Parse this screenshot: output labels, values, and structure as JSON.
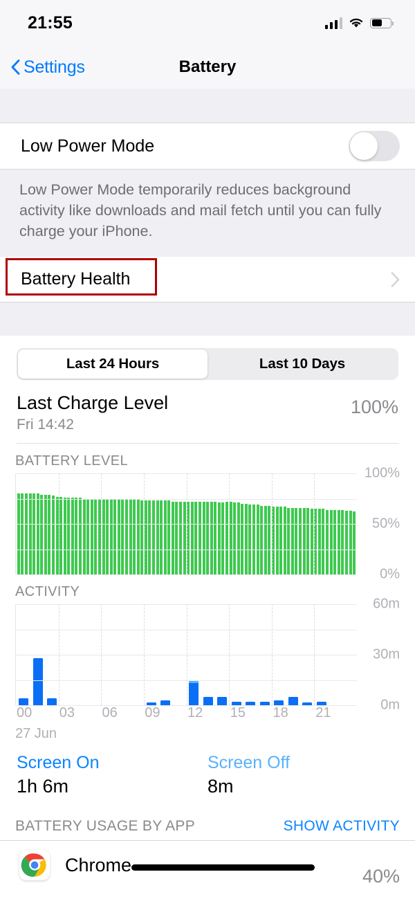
{
  "status_bar": {
    "time": "21:55",
    "signal_icon": "cellular-signal-icon",
    "wifi_icon": "wifi-icon",
    "battery_icon": "battery-icon",
    "battery_fill_pct": 55
  },
  "nav": {
    "back_label": "Settings",
    "title": "Battery",
    "back_icon": "chevron-left-icon",
    "accent": "#007aff"
  },
  "low_power": {
    "label": "Low Power Mode",
    "toggle_state": "off",
    "footnote": "Low Power Mode temporarily reduces background activity like downloads and mail fetch until you can fully charge your iPhone."
  },
  "battery_health": {
    "label": "Battery Health",
    "disclosure_icon": "chevron-right-icon",
    "highlight_color": "#b00000"
  },
  "segmented": {
    "options": [
      {
        "label": "Last 24 Hours",
        "selected": true
      },
      {
        "label": "Last 10 Days",
        "selected": false
      }
    ]
  },
  "last_charge": {
    "title": "Last Charge Level",
    "subtitle": "Fri 14:42",
    "value": "100%"
  },
  "chart_data": [
    {
      "type": "bar",
      "title": "BATTERY LEVEL",
      "xlabel": "",
      "ylabel": "",
      "ylim": [
        0,
        100
      ],
      "ytick_labels": [
        "100%",
        "50%",
        "0%"
      ],
      "ytick_values": [
        100,
        50,
        0
      ],
      "gridlines": [
        100,
        75,
        50,
        25,
        0
      ],
      "grid": true,
      "bar_color": "#3ec94f",
      "x": [
        "00",
        "00",
        "00",
        "00",
        "01",
        "01",
        "01",
        "01",
        "02",
        "02",
        "02",
        "02",
        "03",
        "03",
        "03",
        "03",
        "04",
        "04",
        "04",
        "04",
        "05",
        "05",
        "05",
        "05",
        "06",
        "06",
        "06",
        "06",
        "07",
        "07",
        "07",
        "07",
        "08",
        "08",
        "08",
        "08",
        "09",
        "09",
        "09",
        "09",
        "10",
        "10",
        "10",
        "10",
        "11",
        "11",
        "11",
        "11",
        "12",
        "12",
        "12",
        "12",
        "13",
        "13",
        "13",
        "13",
        "14",
        "14",
        "14",
        "14",
        "15",
        "15",
        "15",
        "15",
        "16",
        "16",
        "16",
        "16",
        "17",
        "17",
        "17",
        "17",
        "18",
        "18",
        "18",
        "18",
        "19",
        "19",
        "19",
        "19",
        "20",
        "20",
        "20",
        "20",
        "21",
        "21",
        "21",
        "21"
      ],
      "values": [
        80,
        80,
        80,
        80,
        80,
        80,
        79,
        79,
        79,
        78,
        77,
        77,
        76,
        76,
        76,
        76,
        76,
        75,
        75,
        75,
        75,
        75,
        75,
        75,
        74,
        74,
        74,
        74,
        74,
        74,
        74,
        74,
        73,
        73,
        73,
        73,
        73,
        73,
        73,
        73,
        72,
        72,
        72,
        72,
        72,
        72,
        72,
        72,
        72,
        72,
        72,
        72,
        71,
        71,
        72,
        72,
        71,
        71,
        70,
        70,
        69,
        69,
        69,
        68,
        68,
        68,
        67,
        67,
        67,
        67,
        66,
        66,
        66,
        66,
        66,
        66,
        65,
        65,
        65,
        65,
        64,
        64,
        64,
        64,
        64,
        63,
        63,
        62
      ]
    },
    {
      "type": "bar",
      "title": "ACTIVITY",
      "xlabel": "",
      "ylabel": "",
      "ylim": [
        0,
        60
      ],
      "ytick_labels": [
        "60m",
        "30m",
        "0m"
      ],
      "ytick_values": [
        60,
        30,
        0
      ],
      "gridlines": [
        60,
        45,
        30,
        15,
        0
      ],
      "grid": true,
      "date_label": "27 Jun",
      "xtick_labels": [
        "00",
        "03",
        "06",
        "09",
        "12",
        "15",
        "18",
        "21"
      ],
      "series": [
        {
          "name": "Screen On",
          "color": "#0a6ff5",
          "values": [
            4,
            28,
            4,
            0,
            0,
            0,
            0,
            0,
            0,
            1,
            3,
            0,
            13,
            5,
            5,
            2,
            2,
            2,
            3,
            5,
            1,
            2,
            0,
            0
          ]
        },
        {
          "name": "Screen Off",
          "color": "#59b0fb",
          "values": [
            0,
            0,
            0,
            0,
            0,
            0,
            0,
            0,
            0,
            0,
            0,
            0,
            2,
            0,
            0,
            0,
            0,
            0,
            0,
            0,
            0,
            0,
            0,
            0
          ]
        }
      ],
      "categories": [
        "00",
        "01",
        "02",
        "03",
        "04",
        "05",
        "06",
        "07",
        "08",
        "09",
        "10",
        "11",
        "12",
        "13",
        "14",
        "15",
        "16",
        "17",
        "18",
        "19",
        "20",
        "21",
        "22",
        "23"
      ]
    }
  ],
  "screen_time": {
    "on_label": "Screen On",
    "on_value": "1h 6m",
    "off_label": "Screen Off",
    "off_value": "8m"
  },
  "usage": {
    "section_title": "BATTERY USAGE BY APP",
    "action_label": "SHOW ACTIVITY",
    "apps": [
      {
        "name": "Chrome",
        "percent": "40%",
        "icon": "chrome-icon",
        "redacted": true
      }
    ]
  }
}
